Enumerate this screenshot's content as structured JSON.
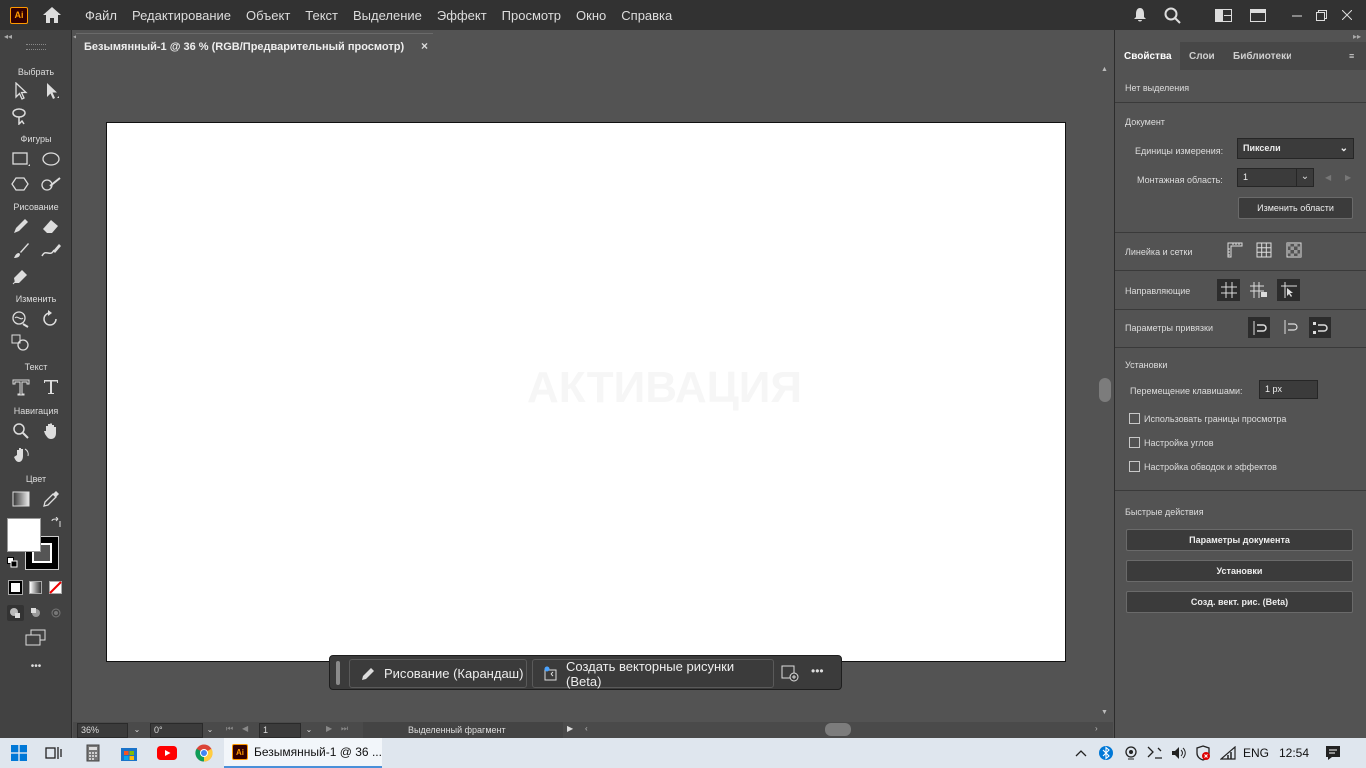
{
  "app": {
    "icon_label": "Ai"
  },
  "menu": [
    "Файл",
    "Редактирование",
    "Объект",
    "Текст",
    "Выделение",
    "Эффект",
    "Просмотр",
    "Окно",
    "Справка"
  ],
  "toolbar": {
    "sections": {
      "select": "Выбрать",
      "shapes": "Фигуры",
      "draw": "Рисование",
      "modify": "Изменить",
      "text": "Текст",
      "nav": "Навигация",
      "color": "Цвет"
    },
    "more": "•••"
  },
  "document": {
    "tab_title": "Безымянный-1 @ 36 % (RGB/Предварительный просмотр)",
    "close": "×",
    "watermark": "АКТИВАЦИЯ"
  },
  "context_bar": {
    "pencil_label": "Рисование (Карандаш)",
    "vectorize_label": "Создать векторные рисунки (Beta)",
    "more": "•••"
  },
  "statusbar": {
    "zoom": "36%",
    "rotation": "0°",
    "artboard": "1",
    "selection": "Выделенный фрагмент"
  },
  "panel": {
    "tabs": [
      "Свойства",
      "Слои",
      "Библиотеки"
    ],
    "no_selection": "Нет выделения",
    "document_heading": "Документ",
    "units_label": "Единицы измерения:",
    "units_value": "Пиксели",
    "artboard_label": "Монтажная область:",
    "artboard_value": "1",
    "edit_artboards": "Изменить области",
    "rulers_grids": "Линейка и сетки",
    "guides": "Направляющие",
    "snap": "Параметры привязки",
    "prefs_heading": "Установки",
    "keyboard_increment_label": "Перемещение клавишами:",
    "keyboard_increment_value": "1 px",
    "use_preview_bounds": "Использовать границы просмотра",
    "scale_corners": "Настройка углов",
    "scale_strokes": "Настройка обводок и эффектов",
    "quick_actions": "Быстрые действия",
    "doc_setup": "Параметры документа",
    "preferences": "Установки",
    "vectorize": "Созд. вект. рис. (Beta)"
  },
  "taskbar": {
    "app_label": "Безымянный-1 @ 36 ...",
    "lang": "ENG",
    "time": "12:54"
  },
  "colors": {
    "fill": "#ffffff",
    "stroke": "#000000",
    "accent": "#ff9a00",
    "chrome": "#323232"
  }
}
